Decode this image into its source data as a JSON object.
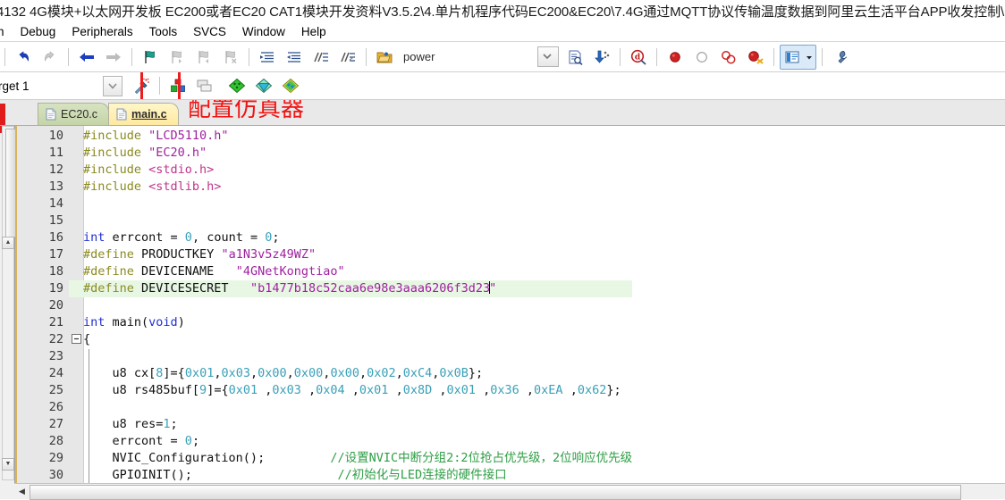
{
  "window": {
    "title": "4132 4G模块+以太网开发板 EC200或者EC20 CAT1模块开发资料V3.5.2\\4.单片机程序代码EC200&EC20\\7.4G通过MQTT协议传输温度数据到阿里云生活平台APP收发控制\\MQT..."
  },
  "menubar": {
    "items": [
      {
        "label": "h",
        "clipped": true
      },
      {
        "label": "Debug"
      },
      {
        "label": "Peripherals"
      },
      {
        "label": "Tools"
      },
      {
        "label": "SVCS"
      },
      {
        "label": "Window"
      },
      {
        "label": "Help"
      }
    ]
  },
  "toolbar1": {
    "undo_icon": "undo-icon",
    "redo_icon": "redo-icon",
    "back_icon": "navigate-back-icon",
    "forward_icon": "navigate-forward-icon",
    "bookmark_icon": "bookmark-toggle-icon",
    "bookmark_prev_icon": "bookmark-previous-icon",
    "bookmark_next_icon": "bookmark-next-icon",
    "bookmark_clear_icon": "bookmark-clear-icon",
    "indent_icon": "indent-icon",
    "outdent_icon": "outdent-icon",
    "comment_icon": "comment-lines-icon",
    "uncomment_icon": "uncomment-lines-icon",
    "openfile_icon": "open-file-icon",
    "scope_label": "power",
    "dropdown_icon": "chevron-down-icon",
    "findinfiles_icon": "find-in-files-icon",
    "goto_icon": "goto-definition-icon",
    "debug_icon": "start-debug-session-icon",
    "breakpoint_icon": "insert-breakpoint-icon",
    "breakpoint_off_icon": "disable-breakpoint-icon",
    "breakpoint_all_off_icon": "disable-all-breakpoints-icon",
    "breakpoint_kill_icon": "kill-all-breakpoints-icon",
    "window_icon": "manage-window-icon",
    "window_arrow_icon": "chevron-down-icon",
    "config_icon": "configure-toolbar-icon"
  },
  "toolbar2": {
    "target_value": "rget 1",
    "target_arrow_icon": "chevron-down-icon",
    "options_icon": "configure-target-options-icon",
    "manage_project_icon": "manage-project-items-icon",
    "multi_project_icon": "manage-multi-project-icon",
    "packinst_icon": "pack-installer-green-icon",
    "packinst2_icon": "pack-installer-teal-icon",
    "packinst3_icon": "pack-installer-multi-icon"
  },
  "annotation": {
    "text": "配置仿真器",
    "color": "#f01414"
  },
  "tabs": [
    {
      "label": "EC20.c",
      "active": false,
      "icon": "c-file-icon"
    },
    {
      "label": "main.c",
      "active": true,
      "icon": "c-file-icon"
    }
  ],
  "editor": {
    "scroll_left_icon": "scroll-left-icon",
    "lines": [
      {
        "num": "10",
        "fold": "",
        "highlight": false,
        "tokens": [
          {
            "t": "#include ",
            "c": "k-pre"
          },
          {
            "t": "\"LCD5110.h\"",
            "c": "k-str"
          }
        ]
      },
      {
        "num": "11",
        "fold": "",
        "highlight": false,
        "tokens": [
          {
            "t": "#include ",
            "c": "k-pre"
          },
          {
            "t": "\"EC20.h\"",
            "c": "k-str"
          }
        ]
      },
      {
        "num": "12",
        "fold": "",
        "highlight": false,
        "tokens": [
          {
            "t": "#include ",
            "c": "k-pre"
          },
          {
            "t": "<stdio.h>",
            "c": "k-ang"
          }
        ]
      },
      {
        "num": "13",
        "fold": "",
        "highlight": false,
        "tokens": [
          {
            "t": "#include ",
            "c": "k-pre"
          },
          {
            "t": "<stdlib.h>",
            "c": "k-ang"
          }
        ]
      },
      {
        "num": "14",
        "fold": "",
        "highlight": false,
        "tokens": []
      },
      {
        "num": "15",
        "fold": "",
        "highlight": false,
        "tokens": []
      },
      {
        "num": "16",
        "fold": "",
        "highlight": false,
        "tokens": [
          {
            "t": "int",
            "c": "k-key"
          },
          {
            "t": " errcont = ",
            "c": "k-id"
          },
          {
            "t": "0",
            "c": "k-num"
          },
          {
            "t": ", count = ",
            "c": "k-id"
          },
          {
            "t": "0",
            "c": "k-num"
          },
          {
            "t": ";",
            "c": "k-id"
          }
        ]
      },
      {
        "num": "17",
        "fold": "",
        "highlight": false,
        "tokens": [
          {
            "t": "#define ",
            "c": "k-pre"
          },
          {
            "t": "PRODUCTKEY ",
            "c": "k-id"
          },
          {
            "t": "\"a1N3v5z49WZ\"",
            "c": "k-str"
          }
        ]
      },
      {
        "num": "18",
        "fold": "",
        "highlight": false,
        "tokens": [
          {
            "t": "#define ",
            "c": "k-pre"
          },
          {
            "t": "DEVICENAME   ",
            "c": "k-id"
          },
          {
            "t": "\"4GNetKongtiao\"",
            "c": "k-str"
          }
        ]
      },
      {
        "num": "19",
        "fold": "",
        "highlight": true,
        "tokens": [
          {
            "t": "#define ",
            "c": "k-pre"
          },
          {
            "t": "DEVICESECRET   ",
            "c": "k-id"
          },
          {
            "t": "\"b1477b18c52caa6e98e3aaa6206f3d23",
            "c": "k-str"
          },
          {
            "t": "|caret|",
            "c": "caret"
          },
          {
            "t": "\"",
            "c": "k-str"
          }
        ]
      },
      {
        "num": "20",
        "fold": "",
        "highlight": false,
        "tokens": []
      },
      {
        "num": "21",
        "fold": "",
        "highlight": false,
        "tokens": [
          {
            "t": "int",
            "c": "k-key"
          },
          {
            "t": " main(",
            "c": "k-id"
          },
          {
            "t": "void",
            "c": "k-key"
          },
          {
            "t": ")",
            "c": "k-id"
          }
        ]
      },
      {
        "num": "22",
        "fold": "minus",
        "highlight": false,
        "tokens": [
          {
            "t": "{",
            "c": "k-id"
          }
        ]
      },
      {
        "num": "23",
        "fold": "",
        "highlight": false,
        "tokens": []
      },
      {
        "num": "24",
        "fold": "",
        "highlight": false,
        "tokens": [
          {
            "t": "    u8 cx[",
            "c": "k-id"
          },
          {
            "t": "8",
            "c": "k-num"
          },
          {
            "t": "]={",
            "c": "k-id"
          },
          {
            "t": "0x01",
            "c": "k-num"
          },
          {
            "t": ",",
            "c": "k-id"
          },
          {
            "t": "0x03",
            "c": "k-num"
          },
          {
            "t": ",",
            "c": "k-id"
          },
          {
            "t": "0x00",
            "c": "k-num"
          },
          {
            "t": ",",
            "c": "k-id"
          },
          {
            "t": "0x00",
            "c": "k-num"
          },
          {
            "t": ",",
            "c": "k-id"
          },
          {
            "t": "0x00",
            "c": "k-num"
          },
          {
            "t": ",",
            "c": "k-id"
          },
          {
            "t": "0x02",
            "c": "k-num"
          },
          {
            "t": ",",
            "c": "k-id"
          },
          {
            "t": "0xC4",
            "c": "k-num"
          },
          {
            "t": ",",
            "c": "k-id"
          },
          {
            "t": "0x0B",
            "c": "k-num"
          },
          {
            "t": "};",
            "c": "k-id"
          }
        ]
      },
      {
        "num": "25",
        "fold": "",
        "highlight": false,
        "tokens": [
          {
            "t": "    u8 rs485buf[",
            "c": "k-id"
          },
          {
            "t": "9",
            "c": "k-num"
          },
          {
            "t": "]={",
            "c": "k-id"
          },
          {
            "t": "0x01",
            "c": "k-num"
          },
          {
            "t": " ,",
            "c": "k-id"
          },
          {
            "t": "0x03",
            "c": "k-num"
          },
          {
            "t": " ,",
            "c": "k-id"
          },
          {
            "t": "0x04",
            "c": "k-num"
          },
          {
            "t": " ,",
            "c": "k-id"
          },
          {
            "t": "0x01",
            "c": "k-num"
          },
          {
            "t": " ,",
            "c": "k-id"
          },
          {
            "t": "0x8D",
            "c": "k-num"
          },
          {
            "t": " ,",
            "c": "k-id"
          },
          {
            "t": "0x01",
            "c": "k-num"
          },
          {
            "t": " ,",
            "c": "k-id"
          },
          {
            "t": "0x36",
            "c": "k-num"
          },
          {
            "t": " ,",
            "c": "k-id"
          },
          {
            "t": "0xEA",
            "c": "k-num"
          },
          {
            "t": " ,",
            "c": "k-id"
          },
          {
            "t": "0x62",
            "c": "k-num"
          },
          {
            "t": "};",
            "c": "k-id"
          }
        ]
      },
      {
        "num": "26",
        "fold": "",
        "highlight": false,
        "tokens": []
      },
      {
        "num": "27",
        "fold": "",
        "highlight": false,
        "tokens": [
          {
            "t": "    u8 res=",
            "c": "k-id"
          },
          {
            "t": "1",
            "c": "k-num"
          },
          {
            "t": ";",
            "c": "k-id"
          }
        ]
      },
      {
        "num": "28",
        "fold": "",
        "highlight": false,
        "tokens": [
          {
            "t": "    errcont = ",
            "c": "k-id"
          },
          {
            "t": "0",
            "c": "k-num"
          },
          {
            "t": ";",
            "c": "k-id"
          }
        ]
      },
      {
        "num": "29",
        "fold": "",
        "highlight": false,
        "tokens": [
          {
            "t": "    NVIC_Configuration();",
            "c": "k-id"
          },
          {
            "t": "         //设置NVIC中断分组2:2位抢占优先级，2位响应优先级",
            "c": "k-cmt"
          }
        ]
      },
      {
        "num": "30",
        "fold": "",
        "highlight": false,
        "tokens": [
          {
            "t": "    GPIOINIT();",
            "c": "k-id"
          },
          {
            "t": "                    //初始化与LED连接的硬件接口",
            "c": "k-cmt"
          }
        ]
      }
    ]
  }
}
